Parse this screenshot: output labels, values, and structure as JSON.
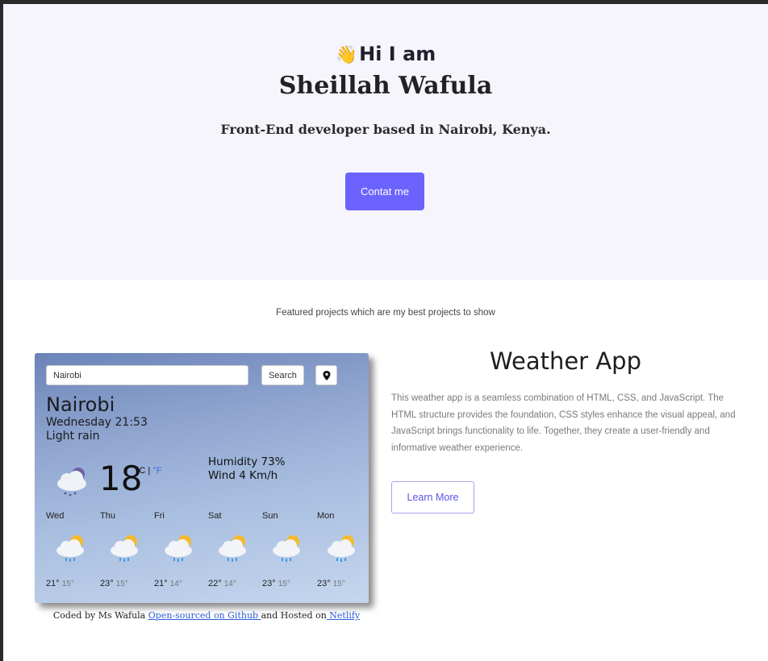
{
  "hero": {
    "greeting": "Hi I am",
    "wave_emoji": "👋",
    "name": "Sheillah Wafula",
    "subtitle": "Front-End developer based in Nairobi, Kenya.",
    "contact_label": "Contat me"
  },
  "projects": {
    "intro": "Featured projects which are my best projects to show",
    "weather_preview": {
      "search_value": "Nairobi",
      "search_button": "Search",
      "location_icon": "map-pin-icon",
      "city": "Nairobi",
      "date": "Wednesday 21:53",
      "description": "Light rain",
      "temperature": "18",
      "unit_c": "°C",
      "unit_sep": " | ",
      "unit_f": "°F",
      "humidity": "Humidity 73%",
      "wind": "Wind 4 Km/h",
      "forecast": [
        {
          "day": "Wed",
          "high": "21°",
          "low": "15°"
        },
        {
          "day": "Thu",
          "high": "23°",
          "low": "15°"
        },
        {
          "day": "Fri",
          "high": "21°",
          "low": "14°"
        },
        {
          "day": "Sat",
          "high": "22°",
          "low": "14°"
        },
        {
          "day": "Sun",
          "high": "23°",
          "low": "15°"
        },
        {
          "day": "Mon",
          "high": "23°",
          "low": "15°"
        }
      ]
    },
    "credit": {
      "prefix": "Coded by Ms Wafula ",
      "github_link": "Open-sourced on Github ",
      "middle": "and Hosted on",
      "netlify_link": " Netlify"
    },
    "title": "Weather App",
    "description": "This weather app is a seamless combination of HTML, CSS, and JavaScript. The HTML structure provides the foundation, CSS styles enhance the visual appeal, and JavaScript brings functionality to life. Together, they create a user-friendly and informative weather experience.",
    "learn_more": "Learn More"
  },
  "colors": {
    "accent": "#6c63ff",
    "hero_bg": "#f6f5fc"
  }
}
